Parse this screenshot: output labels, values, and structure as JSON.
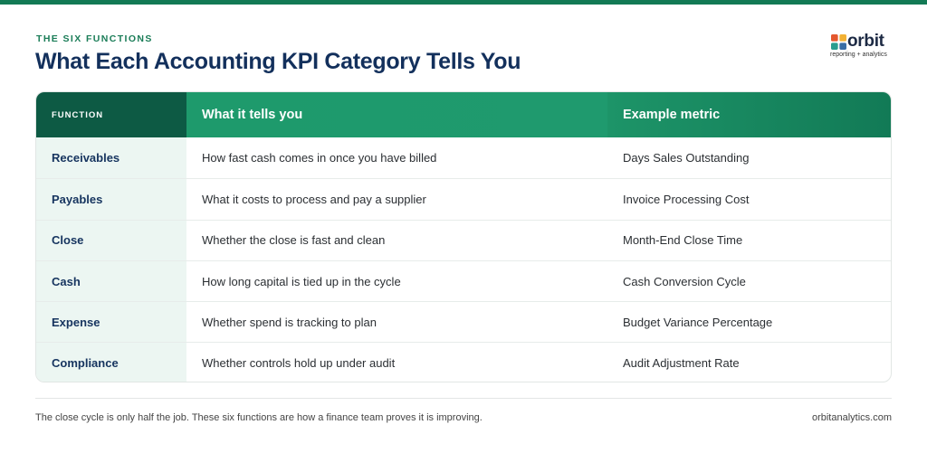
{
  "header": {
    "eyebrow": "THE SIX FUNCTIONS",
    "title": "What Each Accounting KPI Category Tells You"
  },
  "logo": {
    "word": "orbit",
    "tagline": "reporting + analytics",
    "colors": [
      "#e4572e",
      "#f2b134",
      "#2a9d8f",
      "#3a6ea5"
    ]
  },
  "table": {
    "headers": [
      "FUNCTION",
      "What it tells you",
      "Example metric"
    ],
    "rows": [
      {
        "function": "Receivables",
        "tells": "How fast cash comes in once you have billed",
        "metric": "Days Sales Outstanding"
      },
      {
        "function": "Payables",
        "tells": "What it costs to process and pay a supplier",
        "metric": "Invoice Processing Cost"
      },
      {
        "function": "Close",
        "tells": "Whether the close is fast and clean",
        "metric": "Month-End Close Time"
      },
      {
        "function": "Cash",
        "tells": "How long capital is tied up in the cycle",
        "metric": "Cash Conversion Cycle"
      },
      {
        "function": "Expense",
        "tells": "Whether spend is tracking to plan",
        "metric": "Budget Variance Percentage"
      },
      {
        "function": "Compliance",
        "tells": "Whether controls hold up under audit",
        "metric": "Audit Adjustment Rate"
      }
    ]
  },
  "footer": {
    "note": "The close cycle is only half the job. These six functions are how a finance team proves it is improving.",
    "site": "orbitanalytics.com"
  },
  "colors": {
    "accent": "#137a55",
    "header_dark": "#0d5a44",
    "title": "#13305c",
    "function_bg": "#ecf6f2"
  }
}
